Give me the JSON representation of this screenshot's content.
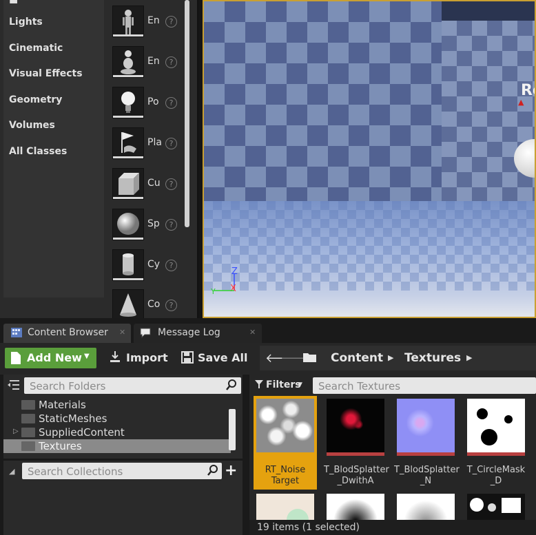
{
  "place_panel": {
    "categories": [
      "Lights",
      "Cinematic",
      "Visual Effects",
      "Geometry",
      "Volumes",
      "All Classes"
    ],
    "items": [
      {
        "label": "En",
        "icon": "character-icon"
      },
      {
        "label": "En",
        "icon": "pawn-icon"
      },
      {
        "label": "Po",
        "icon": "point-light-icon"
      },
      {
        "label": "Pla",
        "icon": "player-start-icon"
      },
      {
        "label": "Cu",
        "icon": "cube-icon"
      },
      {
        "label": "Sp",
        "icon": "sphere-icon"
      },
      {
        "label": "Cy",
        "icon": "cylinder-icon"
      },
      {
        "label": "Co",
        "icon": "cone-icon"
      }
    ],
    "help_glyph": "?"
  },
  "viewport": {
    "object_label": "Ro",
    "axis": {
      "z": "Z",
      "x": "X",
      "y": "Y"
    }
  },
  "tabs": [
    {
      "label": "Content Browser",
      "active": true
    },
    {
      "label": "Message Log",
      "active": false
    }
  ],
  "toolbar": {
    "add_new": "Add New",
    "import": "Import",
    "save_all": "Save All"
  },
  "path": [
    "Content",
    "Textures"
  ],
  "folders": {
    "search_placeholder": "Search Folders",
    "items": [
      {
        "label": "Materials",
        "selected": false,
        "expandable": false
      },
      {
        "label": "StaticMeshes",
        "selected": false,
        "expandable": false
      },
      {
        "label": "SuppliedContent",
        "selected": false,
        "expandable": true
      },
      {
        "label": "Textures",
        "selected": true,
        "expandable": false
      }
    ]
  },
  "collections": {
    "search_placeholder": "Search Collections",
    "add_glyph": "+"
  },
  "assets": {
    "filters_label": "Filters",
    "search_placeholder": "Search Textures",
    "items": [
      {
        "line1": "RT_Noise",
        "line2": "Target",
        "selected": true
      },
      {
        "line1": "T_BlodSplatter",
        "line2": "_DwithA",
        "selected": false
      },
      {
        "line1": "T_BlodSplatter",
        "line2": "_N",
        "selected": false
      },
      {
        "line1": "T_CircleMask",
        "line2": "_D",
        "selected": false
      }
    ],
    "status": "19 items (1 selected)"
  },
  "colors": {
    "accent_green": "#5a9e3b",
    "selection_orange": "#e5a20f",
    "viewport_border": "#c9a032"
  }
}
